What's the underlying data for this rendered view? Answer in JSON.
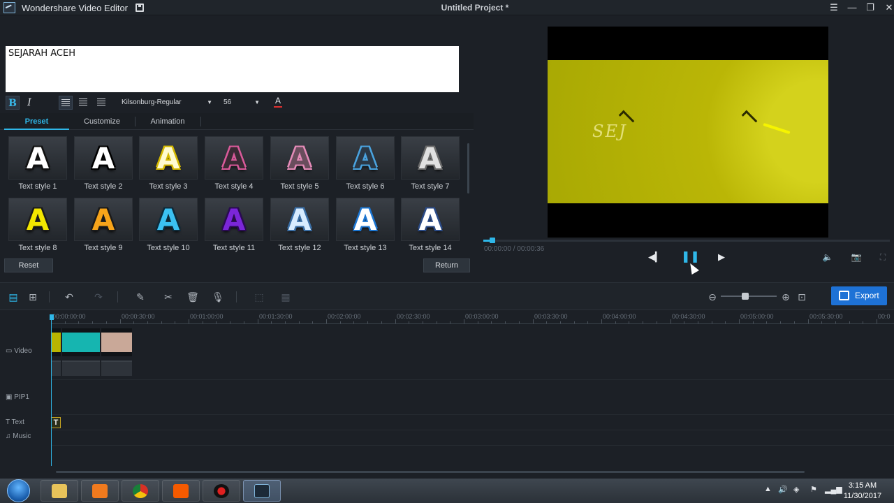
{
  "window": {
    "app_name": "Wondershare Video Editor",
    "project_title": "Untitled Project *",
    "buttons": {
      "menu": "☰",
      "minimize": "—",
      "restore": "❐",
      "close": "✕"
    }
  },
  "editor": {
    "text_value": "SEJARAH ACEH",
    "bold": "B",
    "italic": "I",
    "font_name": "Kilsonburg-Regular",
    "font_size": "56",
    "font_color_glyph": "A",
    "tabs": [
      {
        "label": "Preset",
        "active": true
      },
      {
        "label": "Customize",
        "active": false
      },
      {
        "label": "Animation",
        "active": false
      }
    ],
    "styles": [
      {
        "label": "Text style 1",
        "glyph": "A",
        "color": "#ffffff",
        "outline": "#111111"
      },
      {
        "label": "Text style 2",
        "glyph": "A",
        "color": "#ffffff",
        "outline": "#000000"
      },
      {
        "label": "Text style 3",
        "glyph": "A",
        "color": "#fffbd0",
        "outline": "#d4b800"
      },
      {
        "label": "Text style 4",
        "glyph": "A",
        "color": "#3a2a34",
        "outline": "#d95a9a"
      },
      {
        "label": "Text style 5",
        "glyph": "A",
        "color": "#6a4d5d",
        "outline": "#e48bb8"
      },
      {
        "label": "Text style 6",
        "glyph": "A",
        "color": "#2a3846",
        "outline": "#4aa3df"
      },
      {
        "label": "Text style 7",
        "glyph": "A",
        "color": "#e0e0e0",
        "outline": "#6a6a6a"
      },
      {
        "label": "Text style 8",
        "glyph": "A",
        "color": "#f2e600",
        "outline": "#1a1a1a"
      },
      {
        "label": "Text style 9",
        "glyph": "A",
        "color": "#f7a41a",
        "outline": "#1a1a1a"
      },
      {
        "label": "Text style 10",
        "glyph": "A",
        "color": "#3bc1f2",
        "outline": "#0d2a3a"
      },
      {
        "label": "Text style 11",
        "glyph": "A",
        "color": "#7b26d9",
        "outline": "#2a0a52"
      },
      {
        "label": "Text style 12",
        "glyph": "A",
        "color": "#d8ecff",
        "outline": "#3a6ea5"
      },
      {
        "label": "Text style 13",
        "glyph": "A",
        "color": "#ffffff",
        "outline": "#1b75d1"
      },
      {
        "label": "Text style 14",
        "glyph": "A",
        "color": "#ffffff",
        "outline": "#2a4a86"
      }
    ],
    "reset_label": "Reset",
    "return_label": "Return"
  },
  "preview": {
    "timecode": "00:00:00 / 00:00:36",
    "progress_fraction": 0.012,
    "overlay_text": "SEJ",
    "buttons": {
      "prev": "◀▎",
      "pause": "❚❚",
      "next": "▶",
      "volume": "🔈",
      "snapshot": "📷",
      "fullscreen": "⛶"
    }
  },
  "toolbar": {
    "export_label": "Export",
    "icons": [
      "storyboard-icon",
      "grid-icon",
      "undo-icon",
      "redo-icon",
      "edit-icon",
      "scissors-icon",
      "trash-icon",
      "microphone-icon",
      "crop-icon",
      "split-screen-icon"
    ]
  },
  "timeline": {
    "ruler": [
      "00:00:00:00",
      "00:00:30:00",
      "00:01:00:00",
      "00:01:30:00",
      "00:02:00:00",
      "00:02:30:00",
      "00:03:00:00",
      "00:03:30:00",
      "00:04:00:00",
      "00:04:30:00",
      "00:05:00:00",
      "00:05:30:00",
      "00:0"
    ],
    "tracks": [
      {
        "label": "Video",
        "icon": "film-icon"
      },
      {
        "label": "PIP1",
        "icon": "pip-icon"
      },
      {
        "label": "Text",
        "icon": "text-track-icon"
      },
      {
        "label": "Music",
        "icon": "music-note-icon"
      }
    ],
    "text_clip_label": "T",
    "clip_colors": [
      "#b9b400",
      "#16b5b0",
      "#c9a898"
    ]
  },
  "taskbar": {
    "time": "3:15 AM",
    "date": "11/30/2017",
    "apps": [
      "file-explorer-icon",
      "media-player-icon",
      "chrome-icon",
      "mi-app-icon",
      "recorder-icon",
      "video-editor-icon"
    ]
  }
}
